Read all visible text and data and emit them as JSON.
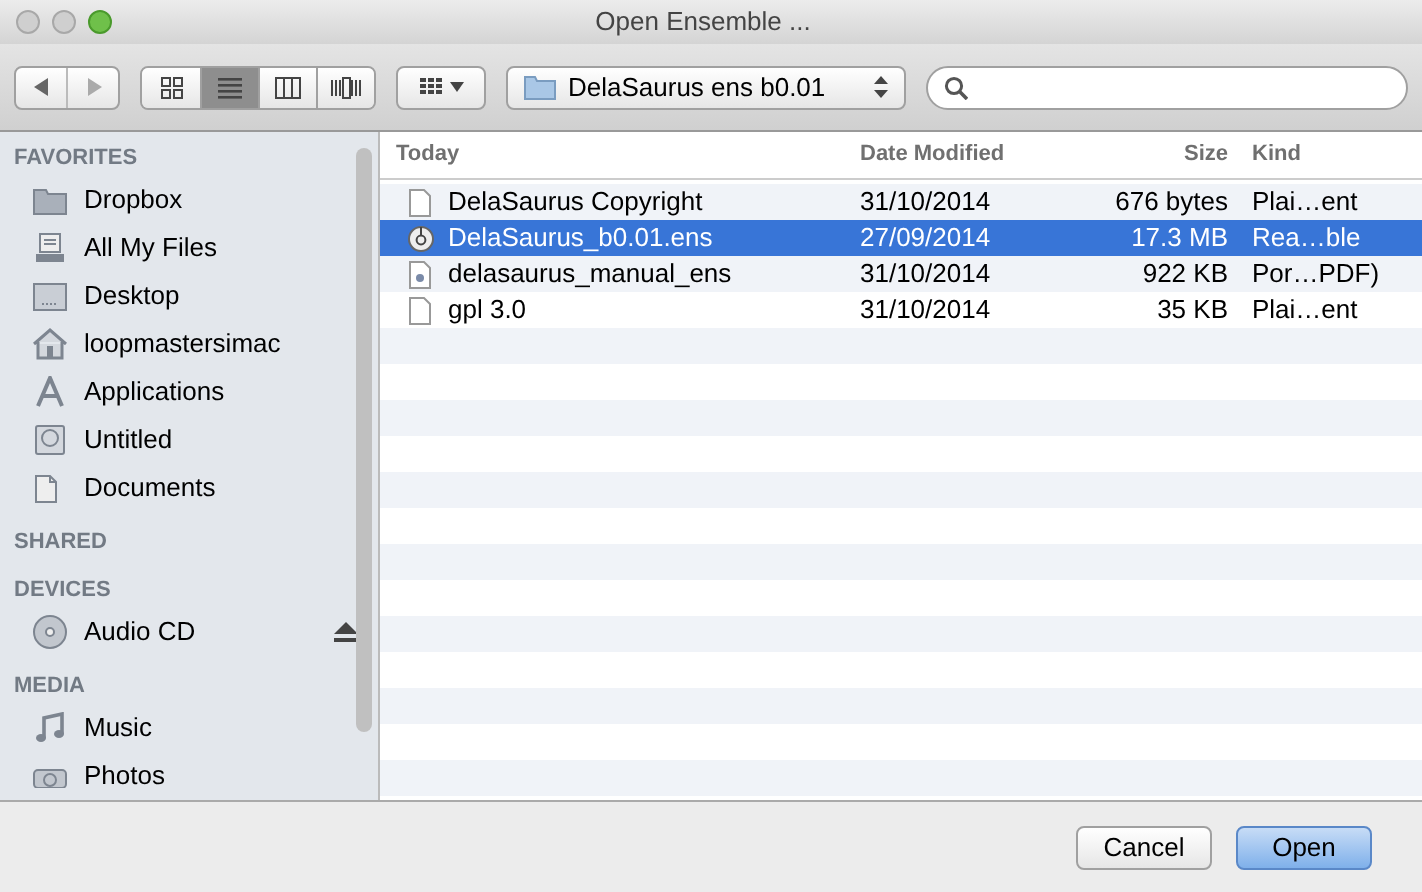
{
  "window": {
    "title": "Open Ensemble ..."
  },
  "toolbar": {
    "views": [
      {
        "kind": "icons",
        "selected": false
      },
      {
        "kind": "list",
        "selected": true
      },
      {
        "kind": "columns",
        "selected": false
      },
      {
        "kind": "coverflow",
        "selected": false
      }
    ],
    "location": "DelaSaurus ens b0.01"
  },
  "sidebar": {
    "sections": [
      {
        "title": "FAVORITES",
        "items": [
          {
            "label": "Dropbox",
            "kind": "folder"
          },
          {
            "label": "All My Files",
            "kind": "files"
          },
          {
            "label": "Desktop",
            "kind": "desktop"
          },
          {
            "label": "loopmastersimac",
            "kind": "home"
          },
          {
            "label": "Applications",
            "kind": "apps"
          },
          {
            "label": "Untitled",
            "kind": "disk"
          },
          {
            "label": "Documents",
            "kind": "docs"
          }
        ]
      },
      {
        "title": "SHARED"
      },
      {
        "title": "DEVICES",
        "items": [
          {
            "label": "Audio CD",
            "kind": "cd",
            "eject": true
          }
        ]
      },
      {
        "title": "MEDIA",
        "items": [
          {
            "label": "Music",
            "kind": "music"
          },
          {
            "label": "Photos",
            "kind": "camera"
          }
        ]
      }
    ]
  },
  "table": {
    "columns": [
      "Today",
      "Date Modified",
      "Size",
      "Kind"
    ],
    "rows": [
      {
        "name": "DelaSaurus Copyright",
        "date": "31/10/2014",
        "size": "676 bytes",
        "file_kind": "Plai…ent",
        "kind": "doc",
        "selected": false
      },
      {
        "name": "DelaSaurus_b0.01.ens",
        "date": "27/09/2014",
        "size": "17.3 MB",
        "file_kind": "Rea…ble",
        "kind": "app",
        "selected": true
      },
      {
        "name": "delasaurus_manual_ens",
        "date": "31/10/2014",
        "size": "922 KB",
        "file_kind": "Por…PDF)",
        "kind": "pdf",
        "selected": false
      },
      {
        "name": "gpl 3.0",
        "date": "31/10/2014",
        "size": "35 KB",
        "file_kind": "Plai…ent",
        "kind": "doc",
        "selected": false
      }
    ]
  },
  "buttons": [
    {
      "label": "Cancel",
      "kind": "normal"
    },
    {
      "label": "Open",
      "kind": "default"
    }
  ]
}
